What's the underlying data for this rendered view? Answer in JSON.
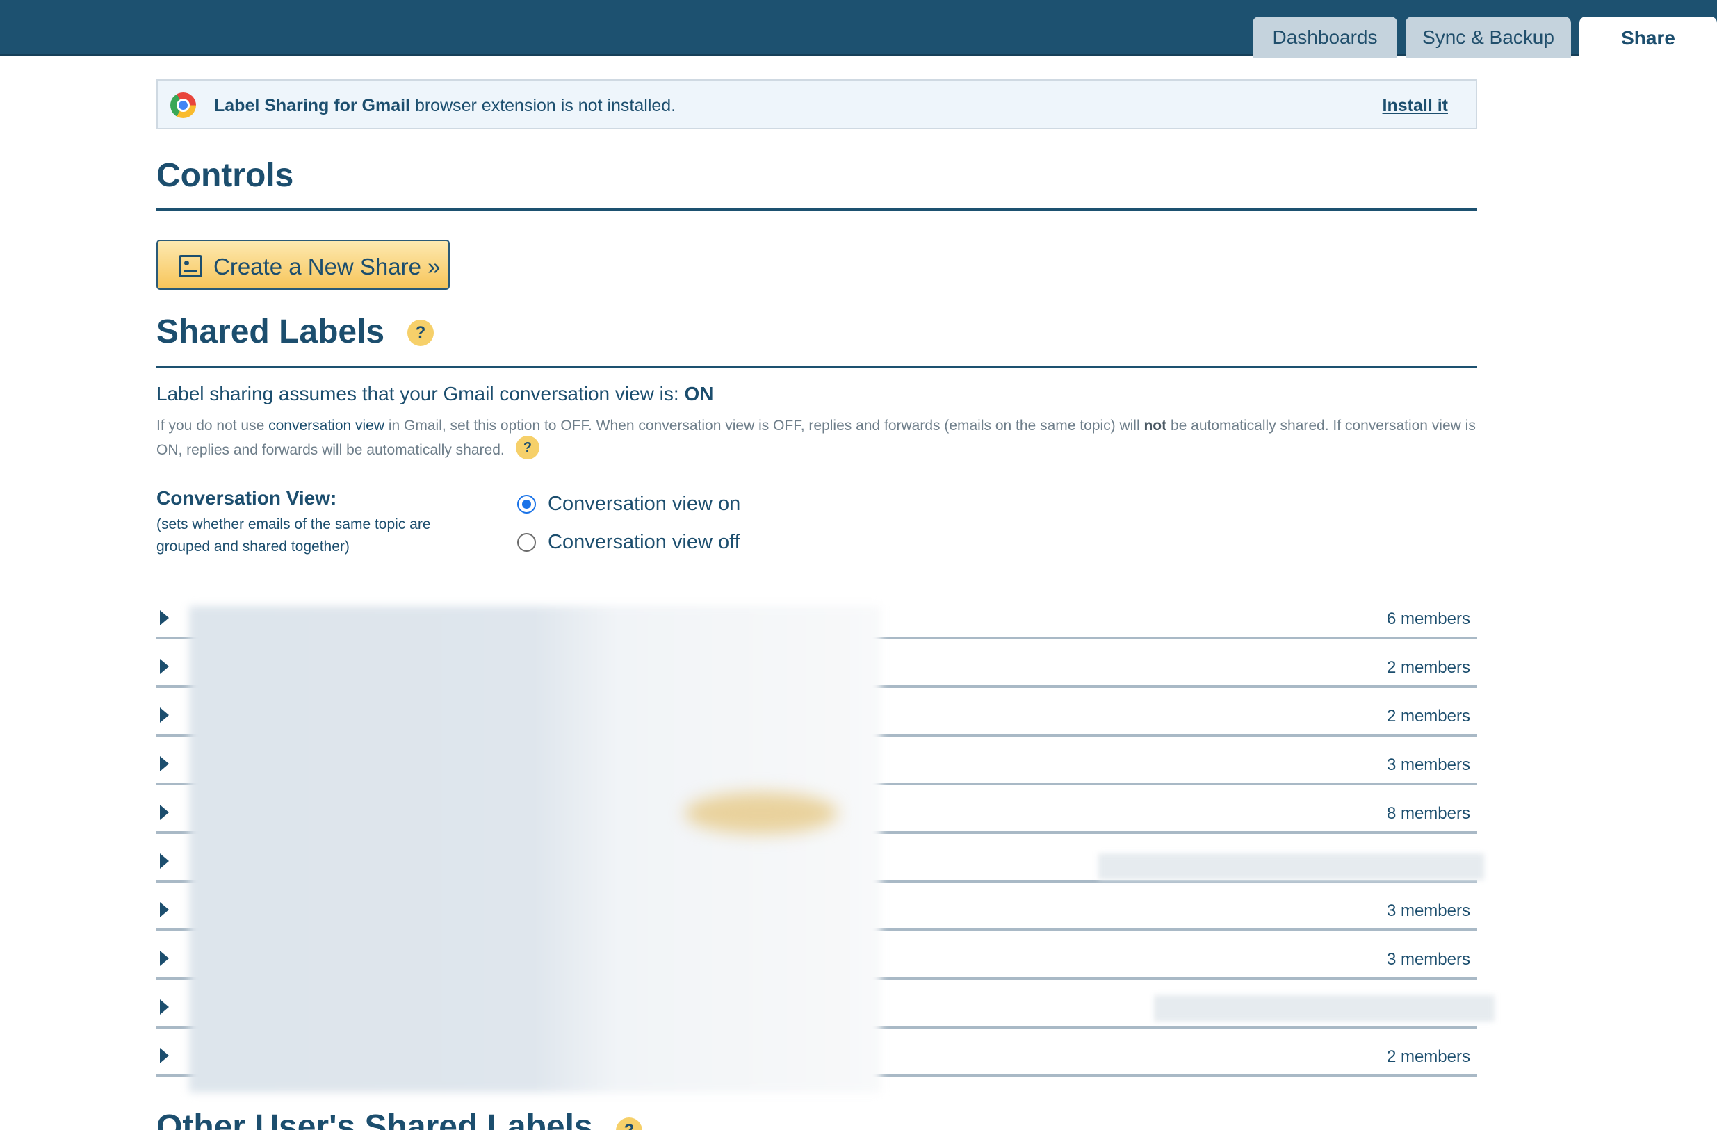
{
  "tabs": [
    {
      "label": "Dashboards",
      "active": false
    },
    {
      "label": "Sync & Backup",
      "active": false
    },
    {
      "label": "Share",
      "active": true
    }
  ],
  "notice": {
    "extension_name": "Label Sharing for Gmail",
    "message": " browser extension is not installed.",
    "install_link": "Install it"
  },
  "controls": {
    "title": "Controls",
    "create_button": "Create a New Share »"
  },
  "shared_labels": {
    "title": "Shared Labels",
    "help_glyph": "?",
    "assume_text": "Label sharing assumes that your Gmail conversation view is: ",
    "assume_value": "ON",
    "para_1": "If you do not use ",
    "para_link": "conversation view",
    "para_2": " in Gmail, set this option to OFF. When conversation view is OFF, replies and forwards (emails on the same topic) will ",
    "para_bold": "not",
    "para_3": " be automatically shared. If conversation view is ON, replies and forwards will be automatically shared.",
    "conversation_view_title": "Conversation View:",
    "conversation_view_desc": "(sets whether emails of the same topic are grouped and shared together)",
    "options": [
      {
        "label": "Conversation view on",
        "selected": true
      },
      {
        "label": "Conversation view off",
        "selected": false
      }
    ],
    "rows": [
      {
        "members": "6 members"
      },
      {
        "members": "2 members"
      },
      {
        "members": "2 members"
      },
      {
        "members": "3 members"
      },
      {
        "members": "8 members"
      },
      {
        "members": ""
      },
      {
        "members": "3 members"
      },
      {
        "members": "3 members"
      },
      {
        "members": ""
      },
      {
        "members": "2 members"
      }
    ]
  },
  "other_users": {
    "title": "Other User's Shared Labels"
  },
  "colors": {
    "header": "#1d5170",
    "accent_button": "#f7c55a",
    "radio_selected": "#1a73e8"
  }
}
